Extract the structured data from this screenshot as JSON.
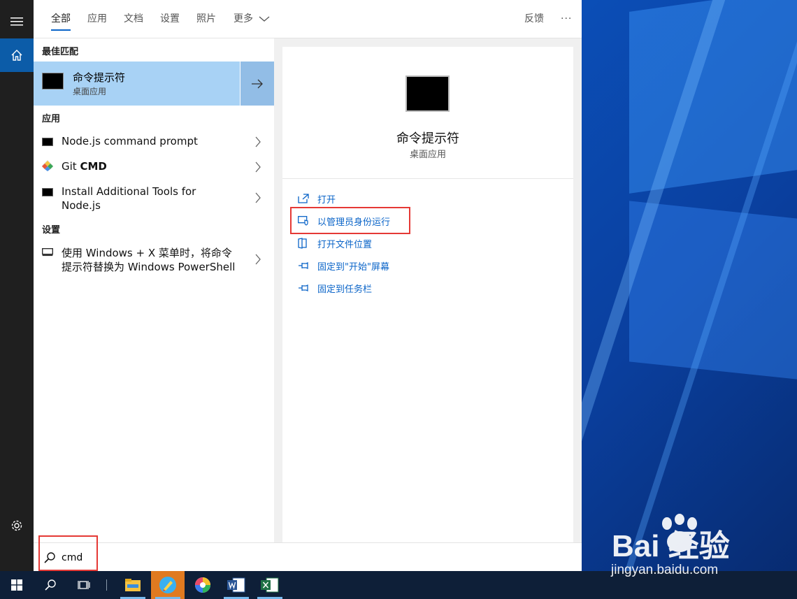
{
  "tabs": [
    {
      "label": "全部",
      "active": true
    },
    {
      "label": "应用"
    },
    {
      "label": "文档"
    },
    {
      "label": "设置"
    },
    {
      "label": "照片"
    },
    {
      "label": "更多"
    }
  ],
  "feedback_label": "反馈",
  "more_dots": "···",
  "sections": {
    "best_match": "最佳匹配",
    "apps": "应用",
    "settings": "设置"
  },
  "best_match": {
    "title": "命令提示符",
    "subtitle": "桌面应用"
  },
  "apps": [
    {
      "label": "Node.js command prompt"
    },
    {
      "label_prefix": "Git ",
      "label_bold": "CMD"
    },
    {
      "label_line1": "Install Additional Tools for",
      "label_line2": "Node.js"
    }
  ],
  "settings_items": [
    {
      "label_line1": "使用 Windows + X 菜单时，将命令",
      "label_line2": "提示符替换为 Windows PowerShell"
    }
  ],
  "preview": {
    "title": "命令提示符",
    "subtitle": "桌面应用",
    "actions": [
      {
        "label": "打开",
        "icon": "open-icon"
      },
      {
        "label": "以管理员身份运行",
        "icon": "shield-icon",
        "highlighted": true
      },
      {
        "label": "打开文件位置",
        "icon": "file-location-icon"
      },
      {
        "label": "固定到\"开始\"屏幕",
        "icon": "pin-icon"
      },
      {
        "label": "固定到任务栏",
        "icon": "pin-icon"
      }
    ]
  },
  "search": {
    "query": "cmd"
  },
  "watermark": {
    "logo_text": "Bai  经验",
    "url": "jingyan.baidu.com"
  },
  "colors": {
    "accent": "#0a64c8",
    "highlight_red": "#e53935",
    "best_match_bg": "#a8d2f5"
  }
}
